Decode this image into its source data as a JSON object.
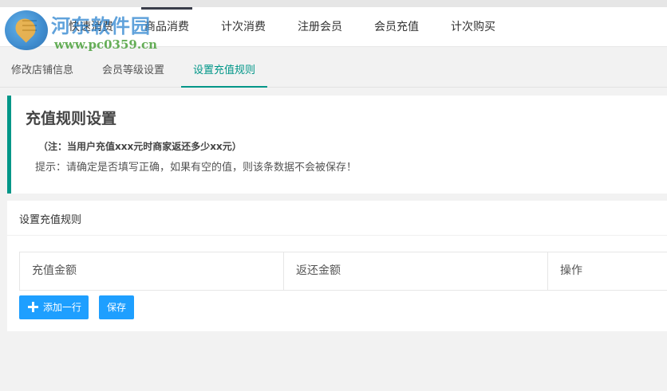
{
  "watermark": {
    "title": "河东软件园",
    "url": "www.pc0359.cn"
  },
  "topnav": {
    "items": [
      {
        "label": "快速消费"
      },
      {
        "label": "商品消费"
      },
      {
        "label": "计次消费"
      },
      {
        "label": "注册会员"
      },
      {
        "label": "会员充值"
      },
      {
        "label": "计次购买"
      }
    ],
    "active_index": 1
  },
  "subtabs": {
    "items": [
      {
        "label": "修改店铺信息"
      },
      {
        "label": "会员等级设置"
      },
      {
        "label": "设置充值规则"
      }
    ],
    "active_index": 2
  },
  "notice": {
    "title": "充值规则设置",
    "note": "（注：当用户充值xxx元时商家返还多少xx元）",
    "tip": "提示：请确定是否填写正确，如果有空的值，则该条数据不会被保存！"
  },
  "panel": {
    "title": "设置充值规则",
    "columns": [
      "充值金额",
      "返还金额",
      "操作"
    ],
    "add_button": "添加一行",
    "save_button": "保存"
  },
  "colors": {
    "accent": "#009688",
    "button": "#1e9fff",
    "nav_active_bar": "#393d49"
  }
}
